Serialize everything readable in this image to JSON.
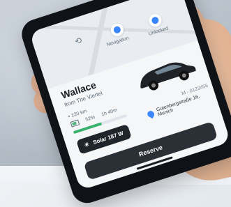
{
  "map": {
    "pin_labels": [
      "Navigation",
      "Unlocked"
    ]
  },
  "listing": {
    "name": "Wallace",
    "subtitle": "from The Viertel",
    "spec_1": "• 120 km",
    "spec_2": "52%",
    "spec_3": "1h 40m",
    "battery_level": 0.52,
    "solar_pill": "Solar 187 W",
    "id_code": "M - 0123456",
    "address": "Gutenbergstraße 16, Munich"
  },
  "actions": {
    "reserve": "Reserve"
  },
  "colors": {
    "accent_blue": "#3a86ff",
    "battery_green": "#37b26c",
    "cta_dark": "#2a3036"
  },
  "icons": [
    "share-icon",
    "navigation-pin-icon",
    "unlocked-pin-icon",
    "battery-icon",
    "location-pin-icon"
  ]
}
